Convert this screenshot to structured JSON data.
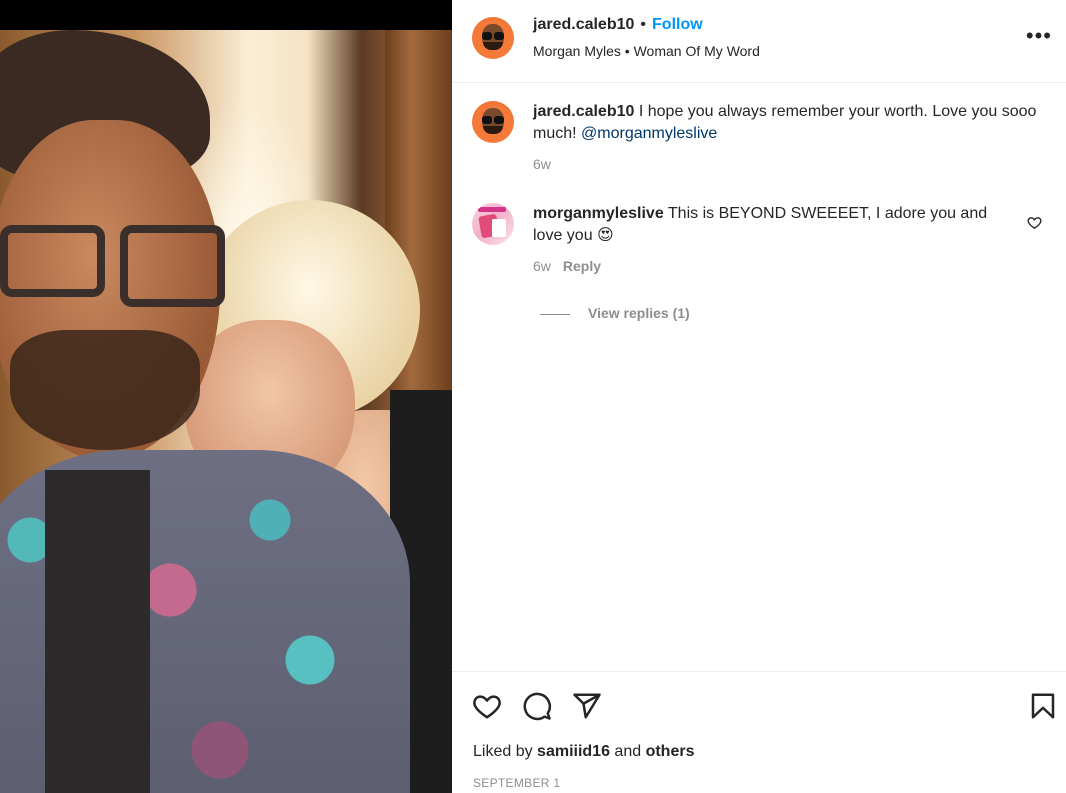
{
  "post": {
    "author": "jared.caleb10",
    "follow_label": "Follow",
    "separator": "•",
    "audio": "Morgan Myles • Woman Of My Word",
    "more_label": "•••"
  },
  "caption": {
    "username": "jared.caleb10",
    "text": " I hope you always remember your worth. Love you sooo much! ",
    "mention": "@morganmyleslive",
    "time": "6w"
  },
  "comments": [
    {
      "username": "morganmyleslive",
      "text": " This is BEYOND SWEEEET, I adore you and love you 😍",
      "time": "6w",
      "reply_label": "Reply",
      "view_replies": "View replies (1)"
    }
  ],
  "footer": {
    "liked_prefix": "Liked by ",
    "liked_user": "samiiid16",
    "liked_and": " and ",
    "liked_others": "others",
    "date": "SEPTEMBER 1"
  },
  "icons": {
    "like": "heart-icon",
    "comment": "comment-icon",
    "share": "paper-plane-icon",
    "save": "bookmark-icon",
    "comment_like": "heart-icon",
    "more": "more-options-icon"
  }
}
